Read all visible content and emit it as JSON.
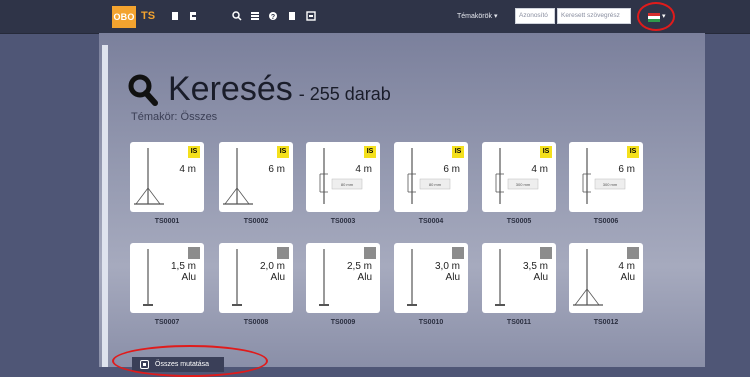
{
  "header": {
    "logo_text": "OBO",
    "app_label": "TS",
    "toolbar_icons": [
      "document-icon",
      "document-export-icon",
      "search-icon",
      "list-icon",
      "help-icon",
      "bookmark-icon",
      "print-icon"
    ],
    "topics_label": "Témakörök ▾",
    "id_input_placeholder": "Azonosító",
    "text_search_placeholder": "Keresett szövegrész",
    "language_flag": "hungarian-flag",
    "language_caret": "▾"
  },
  "page": {
    "title": "Keresés",
    "count_text": "- 255 darab",
    "topic_text": "Témakör: Összes"
  },
  "results": [
    {
      "code": "TS0001",
      "label": "4 m",
      "badge": "IS"
    },
    {
      "code": "TS0002",
      "label": "6 m",
      "badge": "IS"
    },
    {
      "code": "TS0003",
      "label": "4 m",
      "badge": "IS",
      "dim": "80 mm"
    },
    {
      "code": "TS0004",
      "label": "6 m",
      "badge": "IS",
      "dim": "80 mm"
    },
    {
      "code": "TS0005",
      "label": "4 m",
      "badge": "IS",
      "dim": "300 mm"
    },
    {
      "code": "TS0006",
      "label": "6 m",
      "badge": "IS",
      "dim": "300 mm"
    },
    {
      "code": "TS0007",
      "label": "1,5 m",
      "sub": "Alu",
      "badge": "alu-icon"
    },
    {
      "code": "TS0008",
      "label": "2,0 m",
      "sub": "Alu",
      "badge": "alu-icon"
    },
    {
      "code": "TS0009",
      "label": "2,5 m",
      "sub": "Alu",
      "badge": "alu-icon"
    },
    {
      "code": "TS0010",
      "label": "3,0 m",
      "sub": "Alu",
      "badge": "alu-icon"
    },
    {
      "code": "TS0011",
      "label": "3,5 m",
      "sub": "Alu",
      "badge": "alu-icon"
    },
    {
      "code": "TS0012",
      "label": "4 m",
      "sub": "Alu",
      "badge": "alu-icon"
    }
  ],
  "show_all_button": {
    "label": "Összes mutatása"
  },
  "colors": {
    "accent": "#f3a32f",
    "header_bg": "#2f3448",
    "badge_yellow": "#f4e01c",
    "highlight_red": "#e01b1b"
  }
}
